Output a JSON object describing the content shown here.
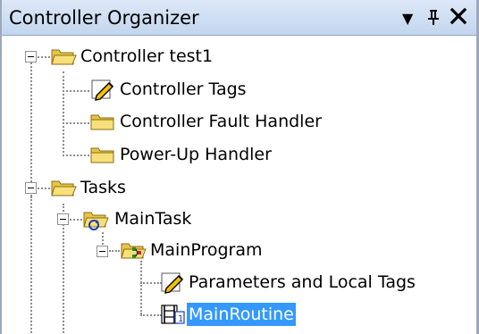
{
  "panel": {
    "title": "Controller Organizer",
    "controls": {
      "dropdown": "▼",
      "pin": "ᛘ",
      "close": "✕"
    }
  },
  "tree": {
    "nodes": [
      {
        "label": "Controller test1",
        "icon": "folder-open-icon",
        "expanded": true,
        "selected": false
      },
      {
        "label": "Controller Tags",
        "icon": "tags-icon",
        "selected": false
      },
      {
        "label": "Controller Fault Handler",
        "icon": "folder-icon",
        "selected": false
      },
      {
        "label": "Power-Up Handler",
        "icon": "folder-icon",
        "selected": false
      },
      {
        "label": "Tasks",
        "icon": "folder-open-icon",
        "expanded": true,
        "selected": false
      },
      {
        "label": "MainTask",
        "icon": "task-icon",
        "expanded": true,
        "selected": false
      },
      {
        "label": "MainProgram",
        "icon": "program-icon",
        "expanded": true,
        "selected": false
      },
      {
        "label": "Parameters and Local Tags",
        "icon": "tags-icon",
        "selected": false
      },
      {
        "label": "MainRoutine",
        "icon": "routine-icon",
        "selected": true
      }
    ]
  },
  "colors": {
    "selection": "#3399ff",
    "titlebar": "#c3d6ee",
    "folder": "#f2d45c"
  }
}
